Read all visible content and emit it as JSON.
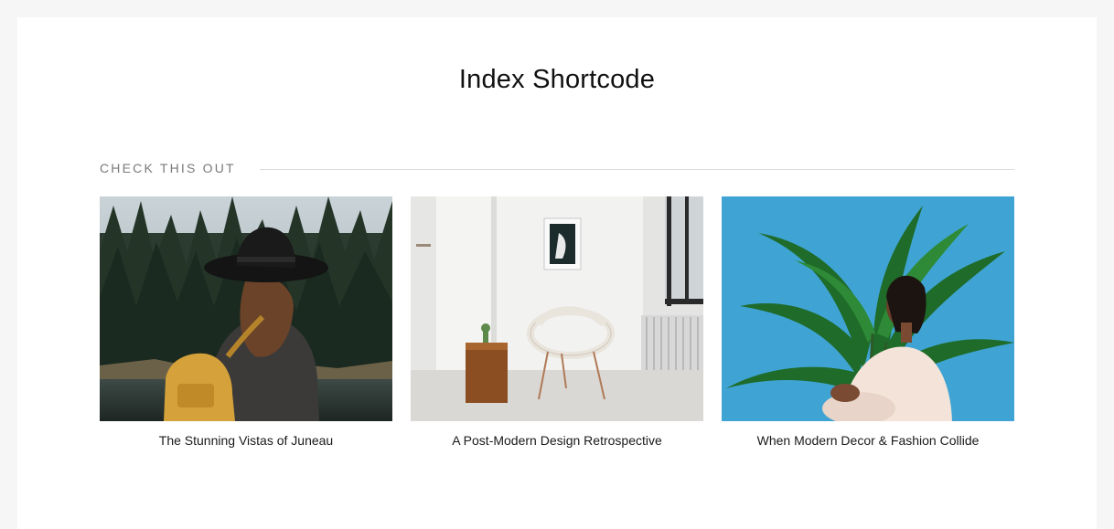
{
  "page": {
    "title": "Index Shortcode"
  },
  "section": {
    "label": "CHECK THIS OUT"
  },
  "posts": [
    {
      "title": "The Stunning Vistas of Juneau",
      "image": "woman-in-hat-forest-photo"
    },
    {
      "title": "A Post-Modern Design Retrospective",
      "image": "white-room-chair-photo"
    },
    {
      "title": "When Modern Decor & Fashion Collide",
      "image": "woman-palm-blue-photo"
    }
  ]
}
